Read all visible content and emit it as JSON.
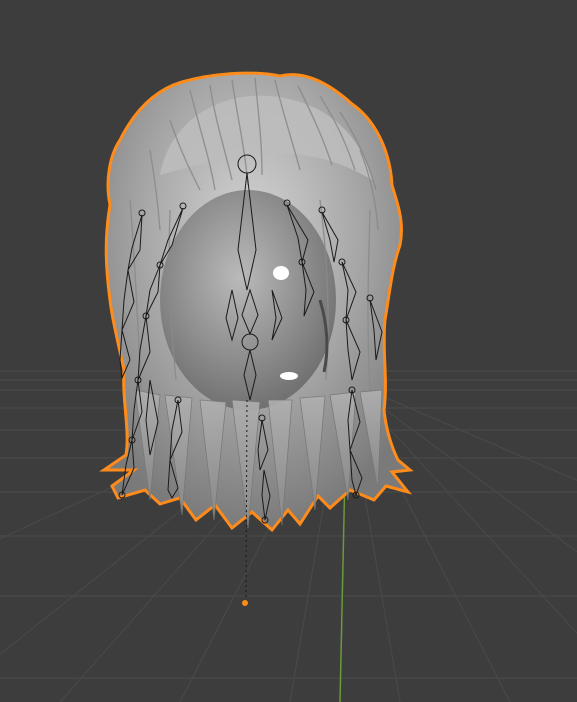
{
  "viewport": {
    "mode": "3D Viewport",
    "background_color": "#3d3d3d",
    "grid_line_color": "#4a4a4a",
    "y_axis_color": "#6a9a3a",
    "selection_outline_color": "#ff8c1a",
    "bone_color": "#1a1a1a",
    "mesh_light_color": "#d8d8d8",
    "mesh_shadow_color": "#6e6e6e"
  },
  "scene": {
    "object": "hair-mesh",
    "armature": "hair-armature",
    "selected": true,
    "origin_point": "armature-origin"
  }
}
